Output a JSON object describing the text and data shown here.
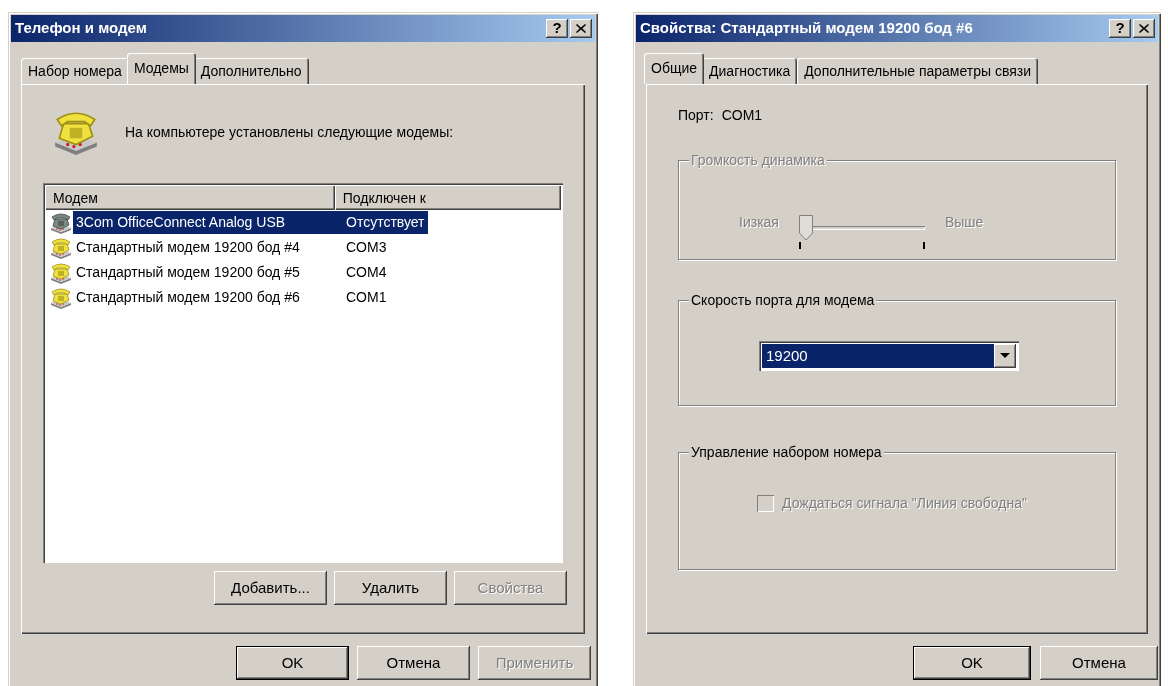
{
  "modems_dialog": {
    "title": "Телефон и модем",
    "help_button": "?",
    "tabs": [
      {
        "label": "Набор номера",
        "selected": false
      },
      {
        "label": "Модемы",
        "selected": true
      },
      {
        "label": "Дополнительно",
        "selected": false
      }
    ],
    "intro": "На компьютере установлены следующие модемы:",
    "list": {
      "columns": [
        "Модем",
        "Подключен к"
      ],
      "rows": [
        {
          "cells": [
            "3Com OfficeConnect Analog USB",
            "Отсутствует"
          ],
          "selected": true,
          "available": false
        },
        {
          "cells": [
            "Стандартный модем 19200 бод #4",
            "COM3"
          ],
          "selected": false,
          "available": true
        },
        {
          "cells": [
            "Стандартный модем 19200 бод #5",
            "COM4"
          ],
          "selected": false,
          "available": true
        },
        {
          "cells": [
            "Стандартный модем 19200 бод #6",
            "COM1"
          ],
          "selected": false,
          "available": true
        }
      ]
    },
    "list_buttons": [
      {
        "label": "Добавить...",
        "disabled": false
      },
      {
        "label": "Удалить",
        "disabled": false
      },
      {
        "label": "Свойства",
        "disabled": true
      }
    ],
    "buttons": [
      {
        "label": "OK",
        "default": true,
        "disabled": false
      },
      {
        "label": "Отмена",
        "default": false,
        "disabled": false
      },
      {
        "label": "Применить",
        "default": false,
        "disabled": true
      }
    ]
  },
  "properties_dialog": {
    "title": "Свойства: Стандартный модем 19200 бод #6",
    "help_button": "?",
    "tabs": [
      {
        "label": "Общие",
        "selected": true
      },
      {
        "label": "Диагностика",
        "selected": false
      },
      {
        "label": "Дополнительные параметры связи",
        "selected": false
      }
    ],
    "port": {
      "label": "Порт:",
      "value": "COM1"
    },
    "volume": {
      "title": "Громкость динамика",
      "disabled": true,
      "low_label": "Iизкая",
      "high_label": "Выше",
      "level": 0
    },
    "speed": {
      "title": "Скорость порта для модема",
      "value": "19200"
    },
    "dialing": {
      "title": "Управление набором номера",
      "checkbox": {
        "label": "Дождаться сигнала \"Линия свободна\"",
        "checked": false,
        "disabled": true
      }
    },
    "buttons": [
      {
        "label": "OK",
        "default": true,
        "disabled": false
      },
      {
        "label": "Отмена",
        "default": false,
        "disabled": false
      }
    ]
  }
}
